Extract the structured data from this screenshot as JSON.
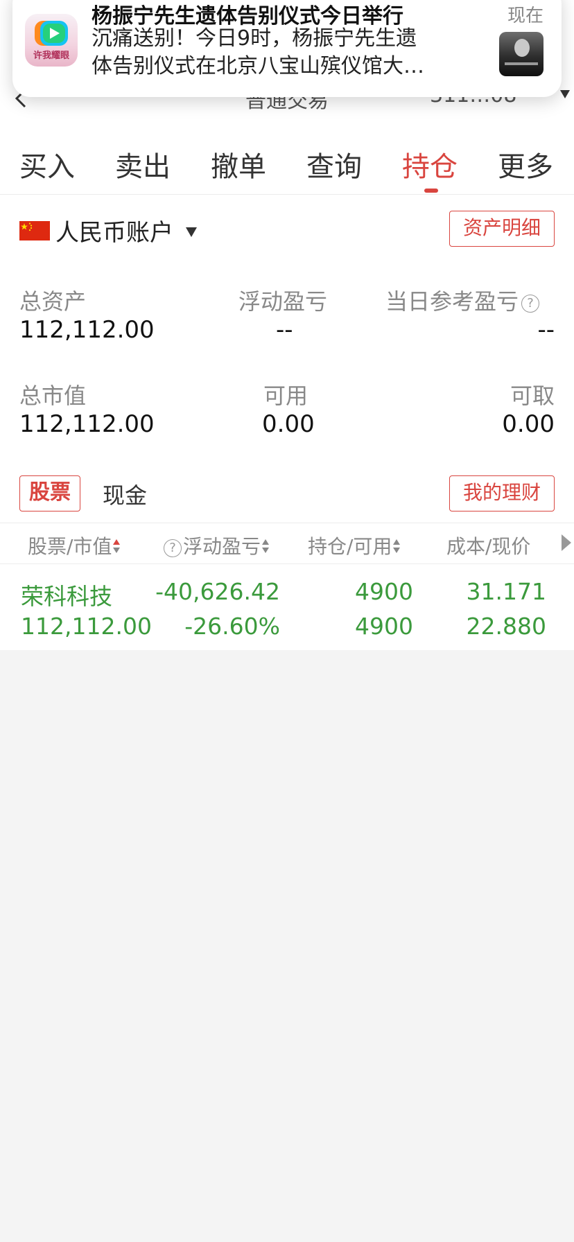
{
  "notification": {
    "app_icon_text": "许我耀眼",
    "title": "杨振宁先生遗体告别仪式今日举行",
    "time": "现在",
    "body_line1": "沉痛送别！今日9时，杨振宁先生遗",
    "body_line2": "体告别仪式在北京八宝山殡仪馆大…"
  },
  "header": {
    "title": "普通交易",
    "account": "311…08"
  },
  "tabs": [
    {
      "label": "买入"
    },
    {
      "label": "卖出"
    },
    {
      "label": "撤单"
    },
    {
      "label": "查询"
    },
    {
      "label": "持仓"
    },
    {
      "label": "更多"
    }
  ],
  "active_tab": "持仓",
  "account": {
    "name": "人民币账户",
    "asset_detail_button": "资产明细"
  },
  "stats": {
    "total_assets_label": "总资产",
    "total_assets_value": "112,112.00",
    "floating_pl_label": "浮动盈亏",
    "floating_pl_value": "--",
    "daily_pl_label": "当日参考盈亏",
    "daily_pl_value": "--",
    "market_value_label": "总市值",
    "market_value_value": "112,112.00",
    "available_label": "可用",
    "available_value": "0.00",
    "withdrawable_label": "可取",
    "withdrawable_value": "0.00"
  },
  "segment": {
    "stock": "股票",
    "cash": "现金",
    "wealth_button": "我的理财"
  },
  "table": {
    "headers": [
      "股票/市值",
      "浮动盈亏",
      "持仓/可用",
      "成本/现价"
    ],
    "rows": [
      {
        "name": "荣科科技",
        "market_value": "112,112.00",
        "floating_pl": "-40,626.42",
        "floating_pl_pct": "-26.60%",
        "holding": "4900",
        "available": "4900",
        "cost": "31.171",
        "price": "22.880"
      }
    ]
  },
  "colors": {
    "accent": "#d9453f",
    "loss_green": "#3b9a3c",
    "label_gray": "#888888",
    "background": "#f4f4f4"
  }
}
